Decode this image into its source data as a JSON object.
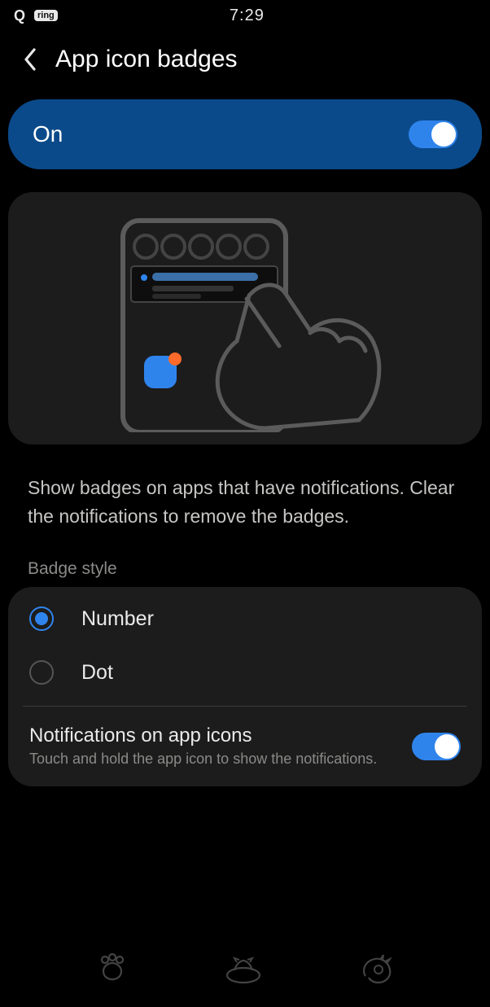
{
  "status": {
    "q_label": "Q",
    "ring_label": "ring",
    "time": "7:29"
  },
  "header": {
    "title": "App icon badges"
  },
  "master_toggle": {
    "label": "On",
    "state": "on"
  },
  "description": "Show badges on apps that have notifications. Clear the notifications to remove the badges.",
  "badge_style": {
    "section_label": "Badge style",
    "options": [
      {
        "label": "Number",
        "selected": true
      },
      {
        "label": "Dot",
        "selected": false
      }
    ]
  },
  "notifications_on_icons": {
    "title": "Notifications on app icons",
    "subtitle": "Touch and hold the app icon to show the notifications.",
    "state": "on"
  },
  "colors": {
    "accent_blue": "#2f84ec",
    "card_bg": "#1c1c1c",
    "master_bg": "#0b4a8a",
    "badge_orange": "#ff6a2b"
  }
}
